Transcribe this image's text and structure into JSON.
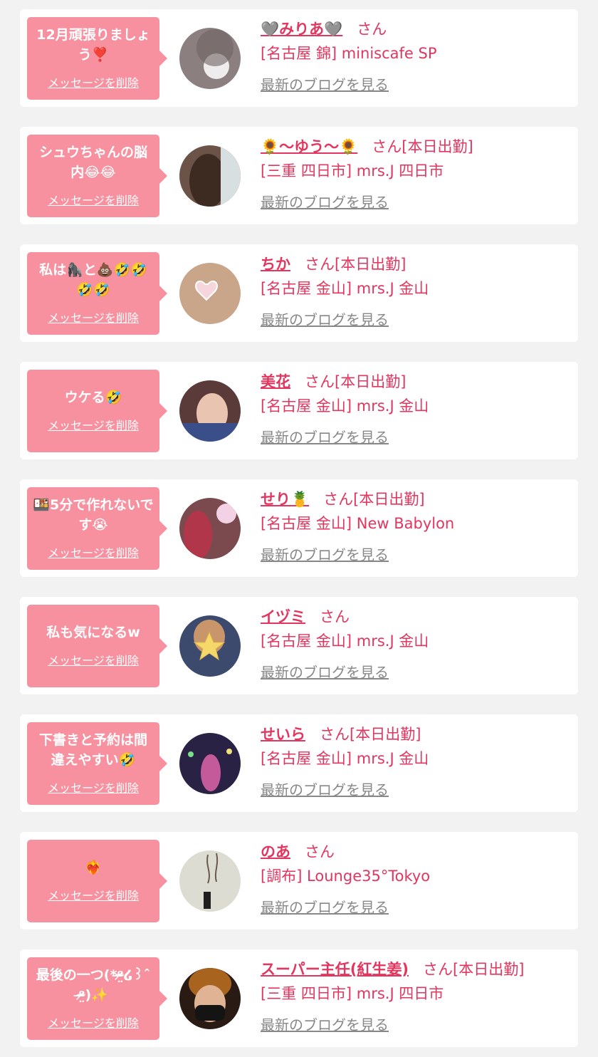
{
  "delete_label": "メッセージを削除",
  "blog_label": "最新のブログを見る",
  "entries": [
    {
      "message": "12月頑張りましょう❣️",
      "name": "🩶みりあ🩶",
      "suffix": "さん",
      "shop": "[名古屋 錦] miniscafe SP",
      "avatar_color": "#8c7f80"
    },
    {
      "message": "シュウちゃんの脳内😂😂",
      "name": "🌻〜ゆう〜🌻",
      "suffix": "さん[本日出勤]",
      "shop": "[三重 四日市] mrs.J 四日市",
      "avatar_color": "#6b5447"
    },
    {
      "message": "私は🦍と💩🤣🤣🤣🤣",
      "name": "ちか",
      "suffix": "さん[本日出勤]",
      "shop": "[名古屋 金山] mrs.J 金山",
      "avatar_color": "#c9a58a"
    },
    {
      "message": "ウケる🤣",
      "name": "美花",
      "suffix": "さん[本日出勤]",
      "shop": "[名古屋 金山] mrs.J 金山",
      "avatar_color": "#5b3b3a"
    },
    {
      "message": "🍱5分で作れないです😭",
      "name": "せり🍍",
      "suffix": "さん[本日出勤]",
      "shop": "[名古屋 金山] New Babylon",
      "avatar_color": "#7a4a4e"
    },
    {
      "message": "私も気になるw",
      "name": "イヅミ",
      "suffix": "さん",
      "shop": "[名古屋 金山] mrs.J 金山",
      "avatar_color": "#3c4a6e"
    },
    {
      "message": "下書きと予約は間違えやすい🤣",
      "name": "せいら",
      "suffix": "さん[本日出勤]",
      "shop": "[名古屋 金山] mrs.J 金山",
      "avatar_color": "#2a2244"
    },
    {
      "message": "❤️‍🔥",
      "name": "のあ",
      "suffix": "さん",
      "shop": "[調布] Lounge35°Tokyo",
      "avatar_color": "#dcdcd2"
    },
    {
      "message": "最後の一つ(*ᵒ̴̶̷̤໒꒱ˆ ᵒ̴̶̷̤)✨",
      "name": "スーパー主任(紅生姜)",
      "suffix": "さん[本日出勤]",
      "shop": "[三重 四日市] mrs.J 四日市",
      "avatar_color": "#2a1a14"
    }
  ]
}
